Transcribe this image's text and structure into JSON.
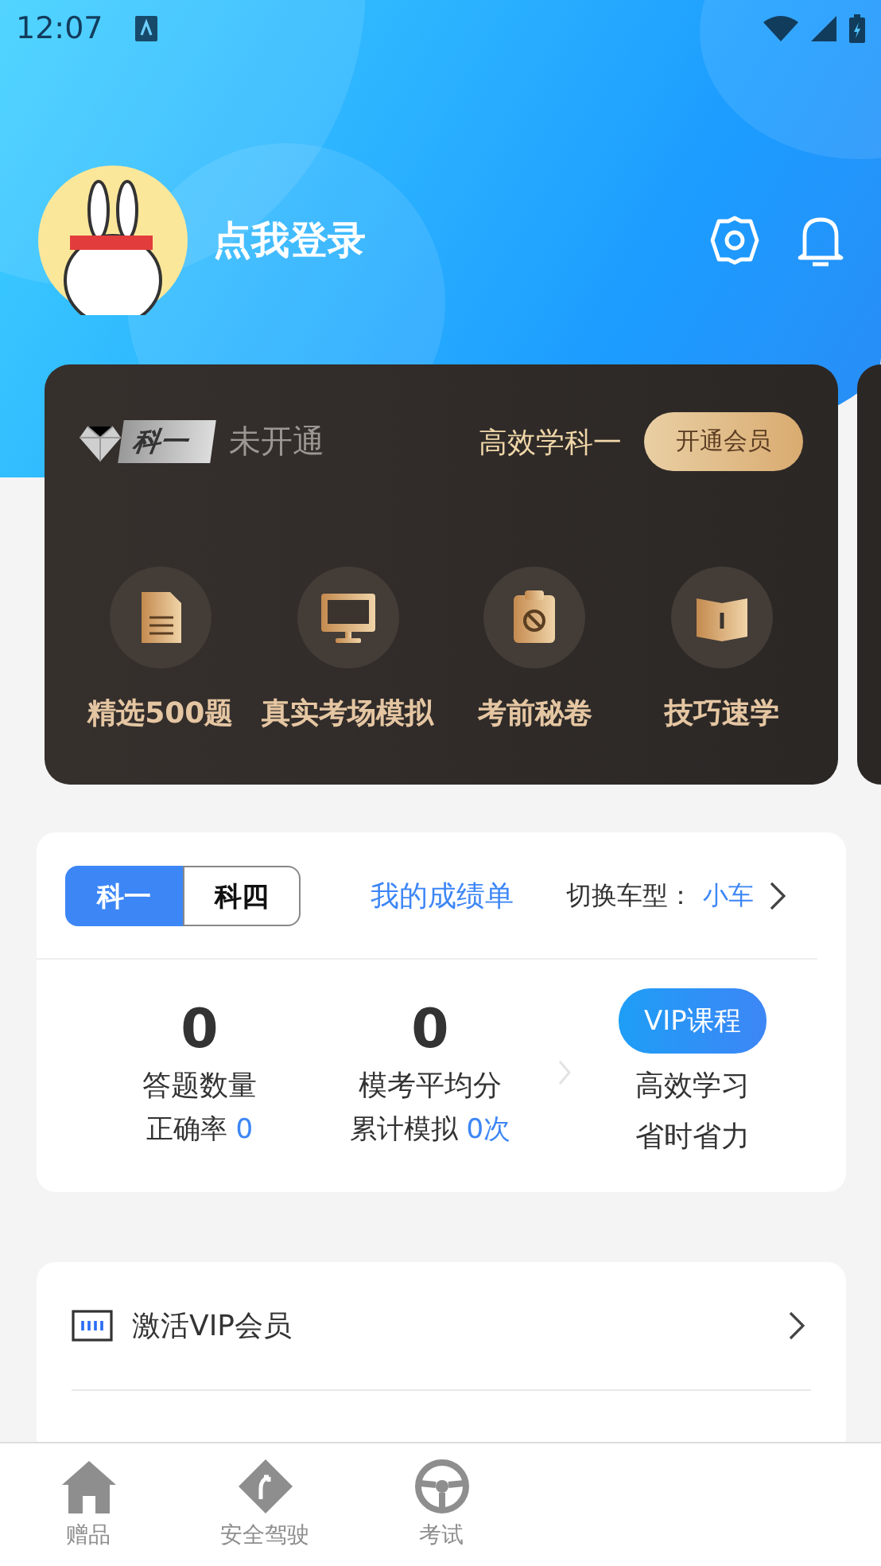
{
  "status_bar": {
    "time": "12:07"
  },
  "profile": {
    "name": "点我登录"
  },
  "vip_card": {
    "badge": "科一",
    "status": "未开通",
    "slogan": "高效学科一",
    "button": "开通会员",
    "features": [
      {
        "label": "精选500题",
        "kind": "document"
      },
      {
        "label": "真实考场模拟",
        "kind": "monitor"
      },
      {
        "label": "考前秘卷",
        "kind": "clipboard"
      },
      {
        "label": "技巧速学",
        "kind": "book"
      }
    ]
  },
  "score_card": {
    "subjects": [
      {
        "label": "科一",
        "selected": true
      },
      {
        "label": "科四",
        "selected": false
      }
    ],
    "report_link": "我的成绩单",
    "vehicle_label": "切换车型：",
    "vehicle": "小车",
    "stats": [
      {
        "value": "0",
        "label": "答题数量",
        "sub_label": "正确率",
        "sub_value": "0"
      },
      {
        "value": "0",
        "label": "模考平均分",
        "sub_label": "累计模拟",
        "sub_value": "0次"
      }
    ],
    "promo": {
      "button": "VIP课程",
      "lines": [
        "高效学习",
        "省时省力"
      ]
    }
  },
  "menu": [
    {
      "label": "激活VIP会员",
      "kind": "card"
    }
  ],
  "tab_bar": [
    {
      "label": "赠品",
      "kind": "home",
      "selected": false
    },
    {
      "label": "安全驾驶",
      "kind": "road",
      "selected": false
    },
    {
      "label": "考试",
      "kind": "wheel",
      "selected": false
    }
  ]
}
